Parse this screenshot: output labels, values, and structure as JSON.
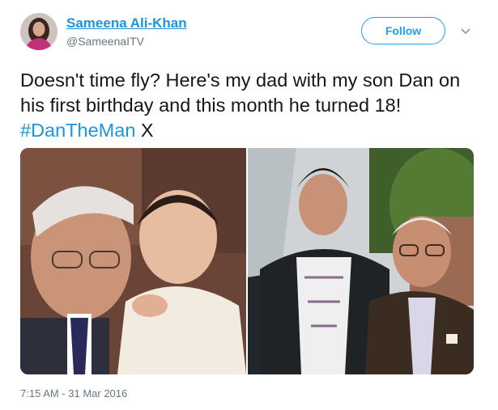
{
  "author": {
    "name": "Sameena Ali-Khan",
    "handle": "@SameenaITV"
  },
  "actions": {
    "follow_label": "Follow"
  },
  "tweet": {
    "text_before": "Doesn't time fly? Here's my dad with my son Dan on his first birthday and this month he turned 18! ",
    "hashtag": "#DanTheMan",
    "text_after": " X"
  },
  "media": {
    "photos": [
      "old-photo-grandfather-with-baby",
      "recent-photo-young-man-with-grandfather"
    ]
  },
  "meta": {
    "timestamp": "7:15 AM - 31 Mar 2016"
  },
  "colors": {
    "link": "#1b95e0",
    "follow_border": "#1da1f2",
    "secondary_text": "#657786"
  },
  "icons": {
    "more": "chevron-down-icon"
  }
}
